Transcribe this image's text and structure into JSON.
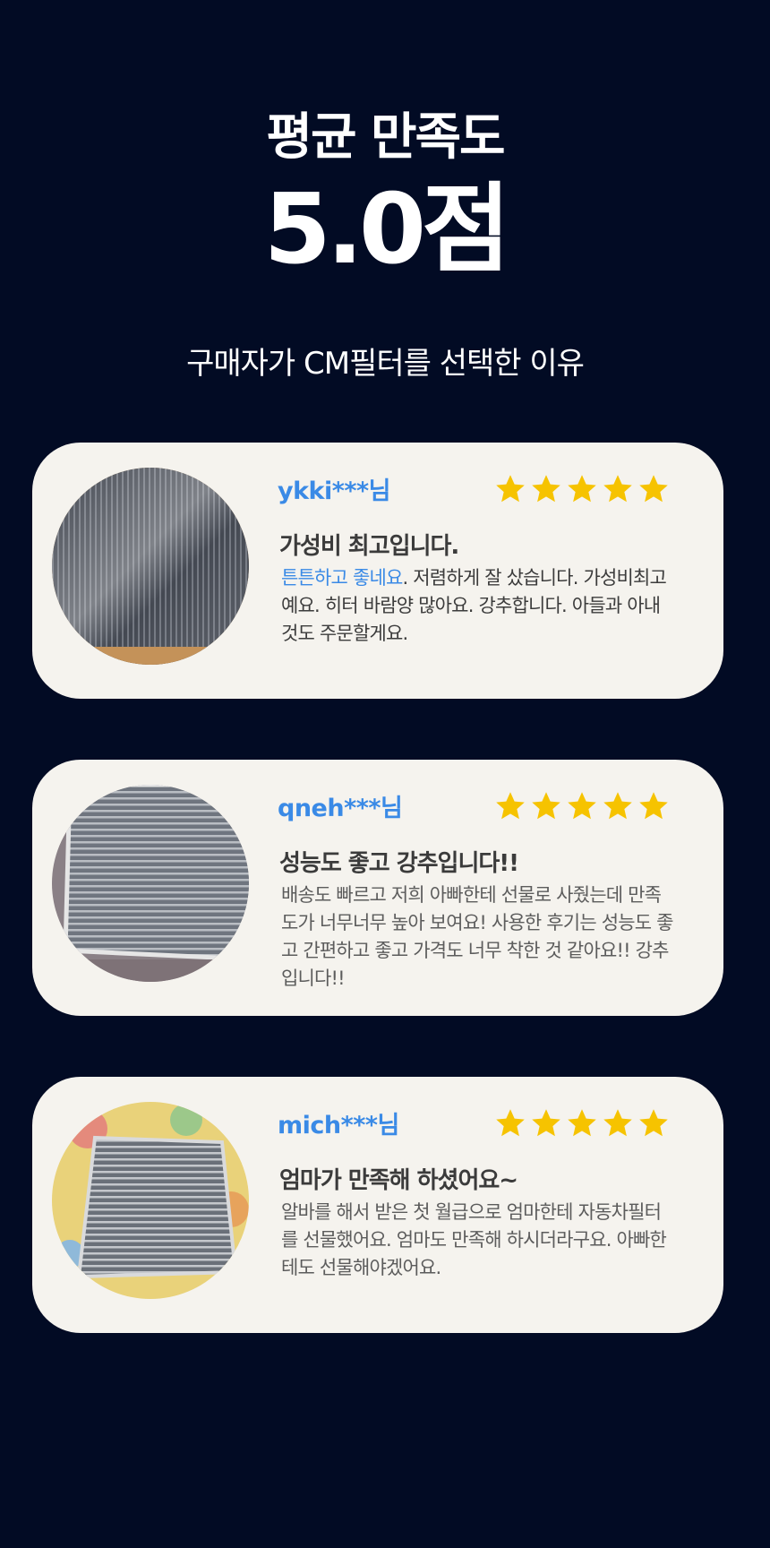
{
  "header": {
    "title": "평균 만족도",
    "score": "5.0점",
    "subtitle": "구매자가 CM필터를 선택한 이유"
  },
  "colors": {
    "background": "#020b24",
    "card": "#f5f3ee",
    "accent_blue": "#3a8ae6",
    "star": "#f6c300"
  },
  "reviews": [
    {
      "author": "ykki***님",
      "rating": 5,
      "title": "가성비 최고입니다.",
      "highlight": "튼튼하고 좋네요",
      "body_rest": ". 저렴하게 잘 샀습니다. 가성비최고예요. 히터 바람양 많아요. 강추합니다. 아들과 아내것도 주문할게요.",
      "photo_icon": "cabin-filter-in-plastic-photo"
    },
    {
      "author": "qneh***님",
      "rating": 5,
      "title": "성능도 좋고 강추입니다!!",
      "body": "배송도 빠르고 저희 아빠한테 선물로 사줬는데 만족도가 너무너무 높아 보여요! 사용한 후기는 성능도 좋고 간편하고 좋고 가격도 너무 착한 것 같아요!! 강추입니다!!",
      "photo_icon": "cabin-filter-photo"
    },
    {
      "author": "mich***님",
      "rating": 5,
      "title": "엄마가 만족해 하셨어요~",
      "body": "알바를 해서 받은 첫 월급으로 엄마한테 자동차필터를 선물했어요. 엄마도 만족해 하시더라구요. 아빠한테도 선물해야겠어요.",
      "photo_icon": "cabin-filter-on-playmat-photo"
    }
  ]
}
